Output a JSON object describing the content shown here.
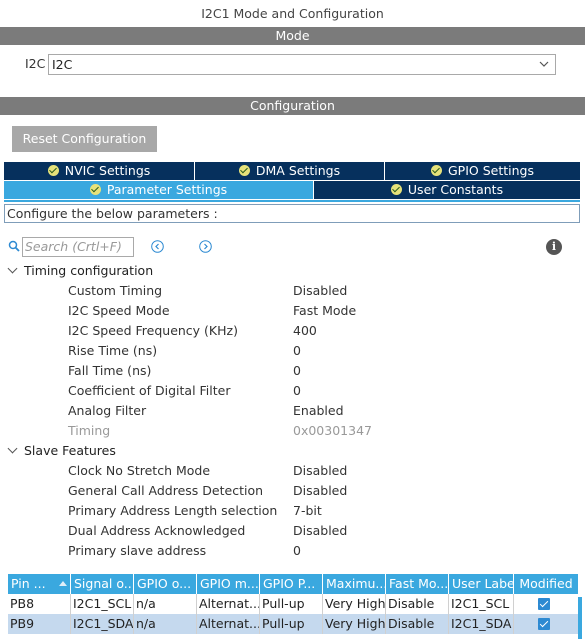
{
  "window": {
    "title": "I2C1 Mode and Configuration"
  },
  "mode": {
    "section_label": "Mode",
    "field_label": "I2C",
    "selected_value": "I2C"
  },
  "configuration": {
    "section_label": "Configuration",
    "reset_button": "Reset Configuration",
    "tabs": [
      {
        "label": "NVIC Settings",
        "active": false
      },
      {
        "label": "DMA Settings",
        "active": false
      },
      {
        "label": "GPIO Settings",
        "active": false
      },
      {
        "label": "Parameter Settings",
        "active": true
      },
      {
        "label": "User Constants",
        "active": false
      }
    ],
    "description": "Configure the below parameters :",
    "search": {
      "placeholder": "Search (Crtl+F)"
    }
  },
  "groups": [
    {
      "title": "Timing configuration",
      "params": [
        {
          "name": "Custom Timing",
          "value": "Disabled",
          "disabled": false
        },
        {
          "name": "I2C Speed Mode",
          "value": "Fast Mode",
          "disabled": false
        },
        {
          "name": "I2C Speed Frequency (KHz)",
          "value": "400",
          "disabled": false
        },
        {
          "name": "Rise Time (ns)",
          "value": "0",
          "disabled": false
        },
        {
          "name": "Fall Time (ns)",
          "value": "0",
          "disabled": false
        },
        {
          "name": "Coefficient of Digital Filter",
          "value": "0",
          "disabled": false
        },
        {
          "name": "Analog Filter",
          "value": "Enabled",
          "disabled": false
        },
        {
          "name": "Timing",
          "value": "0x00301347",
          "disabled": true
        }
      ]
    },
    {
      "title": "Slave Features",
      "params": [
        {
          "name": "Clock No Stretch Mode",
          "value": "Disabled",
          "disabled": false
        },
        {
          "name": "General Call Address Detection",
          "value": "Disabled",
          "disabled": false
        },
        {
          "name": "Primary Address Length selection",
          "value": "7-bit",
          "disabled": false
        },
        {
          "name": "Dual Address Acknowledged",
          "value": "Disabled",
          "disabled": false
        },
        {
          "name": "Primary slave address",
          "value": "0",
          "disabled": false
        }
      ]
    }
  ],
  "gpio_table": {
    "columns": [
      "Pin ...",
      "Signal o...",
      "GPIO o...",
      "GPIO m...",
      "GPIO P...",
      "Maximu...",
      "Fast Mo...",
      "User Label",
      "Modified"
    ],
    "rows": [
      {
        "cells": [
          "PB8",
          "I2C1_SCL",
          "n/a",
          "Alternat...",
          "Pull-up",
          "Very High",
          "Disable",
          "I2C1_SCL"
        ],
        "modified": true,
        "selected": false
      },
      {
        "cells": [
          "PB9",
          "I2C1_SDA",
          "n/a",
          "Alternat...",
          "Pull-up",
          "Very High",
          "Disable",
          "I2C1_SDA"
        ],
        "modified": true,
        "selected": true
      }
    ]
  },
  "colors": {
    "section_bar": "#7b7b7b",
    "tab_inactive": "#06305d",
    "tab_active": "#3aa8df",
    "table_header": "#3aa8df",
    "selected_row": "#c5d9ee"
  }
}
